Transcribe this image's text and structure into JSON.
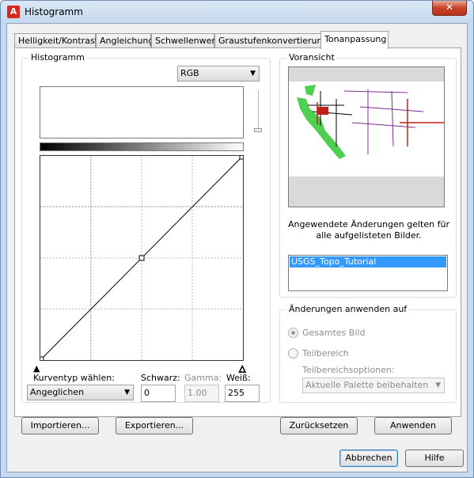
{
  "window": {
    "title": "Histogramm",
    "app_icon": "A",
    "close_glyph": "✕",
    "accent_color": "#d6281d"
  },
  "tabs": [
    {
      "label": "Helligkeit/Kontrast"
    },
    {
      "label": "Angleichung"
    },
    {
      "label": "Schwellenwert"
    },
    {
      "label": "Graustufenkonvertierung"
    },
    {
      "label": "Tonanpassung",
      "active": true
    }
  ],
  "histogram": {
    "group_label": "Histogramm",
    "channel": "RGB",
    "curve": {
      "type_label": "Kurventyp wählen:",
      "type_value": "Angeglichen",
      "points": [
        [
          0,
          0
        ],
        [
          0.5,
          0.5
        ],
        [
          1,
          1
        ]
      ]
    },
    "black_label": "Schwarz:",
    "black_value": "0",
    "gamma_label": "Gamma:",
    "gamma_value": "1.00",
    "white_label": "Weiß:",
    "white_value": "255",
    "import_button": "Importieren...",
    "export_button": "Exportieren..."
  },
  "preview": {
    "group_label": "Voransicht",
    "note": "Angewendete Änderungen gelten für alle aufgelisteten Bilder.",
    "images": [
      "USGS_Topo_Tutorial"
    ]
  },
  "apply_to": {
    "group_label": "Änderungen anwenden auf",
    "option_whole": "Gesamtes Bild",
    "option_partial": "Teilbereich",
    "subrange_label": "Teilbereichsoptionen:",
    "subrange_value": "Aktuelle Palette beibehalten"
  },
  "actions": {
    "reset": "Zurücksetzen",
    "apply": "Anwenden",
    "cancel": "Abbrechen",
    "help": "Hilfe"
  }
}
